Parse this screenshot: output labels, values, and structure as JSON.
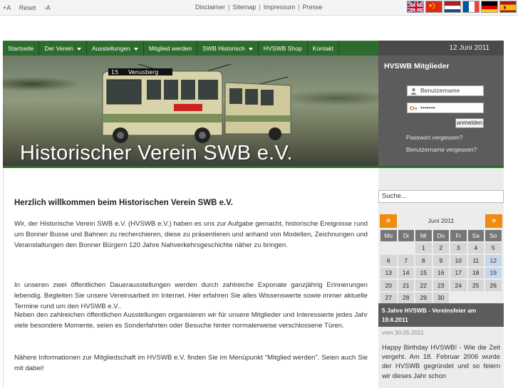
{
  "topbar": {
    "fontsize": [
      "+A",
      "Reset",
      "-A"
    ],
    "links": [
      "Disclaimer",
      "Sitemap",
      "Impressum",
      "Presse"
    ],
    "flags": [
      "UK",
      "China",
      "Netherlands",
      "France",
      "Germany",
      "Spain"
    ]
  },
  "nav": {
    "items": [
      {
        "label": "Startseite",
        "dropdown": false
      },
      {
        "label": "Der Verein",
        "dropdown": true
      },
      {
        "label": "Ausstellungen",
        "dropdown": true
      },
      {
        "label": "Mitglied werden",
        "dropdown": false
      },
      {
        "label": "SWB Historisch",
        "dropdown": true
      },
      {
        "label": "HVSWB Shop",
        "dropdown": false
      },
      {
        "label": "Kontakt",
        "dropdown": false
      }
    ],
    "date": "12 Juni 2011"
  },
  "header": {
    "title": "Historischer Verein SWB e.V.",
    "bus_destination": "Venusberg",
    "bus_number": "15"
  },
  "login": {
    "title": "HVSWB Mitglieder",
    "username_placeholder": "Benutzername",
    "password_value": "•••••••",
    "button": "anmelden",
    "forgot_password": "Passwort vergessen?",
    "forgot_username": "Benutzername vergessen?"
  },
  "main": {
    "heading": "Herzlich willkommen beim Historischen Verein SWB e.V.",
    "paragraphs": [
      "Wir, der Historische Verein SWB e.V. (HVSWB e.V.) haben es uns zur Aufgabe gemacht, historische Ereignisse rund um Bonner Busse und Bahnen zu recherchieren, diese zu präsentieren und anhand von Modellen, Zeichnungen und Veranstaltungen den Bonner Bürgern 120 Jahre Nahverkehrsgeschichte näher zu bringen.",
      "In unseren zwei öffentlichen Dauerausstellungen werden durch zahlreiche Exponate ganzjährig Erinnerungen lebendig. Begleiten Sie unsere Vereinsarbeit im Internet. Hier erfahren Sie alles Wissenswerte sowie immer aktuelle Termine rund um den HVSWB e.V..",
      "Neben den zahlreichen öffentlichen Ausstellungen organisieren wir für unsere Mitglieder und Interessierte jedes Jahr viele besondere Momente, seien es Sonderfahrten oder Besuche hinter normalerweise verschlossene Türen.",
      "Nähere Informationen zur Mitgliedschaft im HVSWB e.V. finden Sie im Menüpunkt \"Mitglied werden\". Seien auch Sie mit dabei!"
    ]
  },
  "sidebar": {
    "search_placeholder": "Suche...",
    "calendar": {
      "prev": "«",
      "next": "»",
      "month": "Juni 2011",
      "weekdays": [
        "Mo",
        "Di",
        "Mi",
        "Do",
        "Fr",
        "Sa",
        "So"
      ],
      "weeks": [
        [
          "",
          "",
          "1",
          "2",
          "3",
          "4",
          "5"
        ],
        [
          "6",
          "7",
          "8",
          "9",
          "10",
          "11",
          "12"
        ],
        [
          "13",
          "14",
          "15",
          "16",
          "17",
          "18",
          "19"
        ],
        [
          "20",
          "21",
          "22",
          "23",
          "24",
          "25",
          "26"
        ],
        [
          "27",
          "28",
          "29",
          "30",
          "",
          "",
          ""
        ]
      ],
      "today": "12",
      "marked": [
        "19"
      ]
    },
    "news": {
      "title": "5 Jahre HVSWB - Vereinsfeier am 19.6.2011",
      "date": "vom 30.05.2011",
      "text": "Happy Birthday HVSWB! - Wie die Zeit vergeht. Am 18. Februar 2006 wurde der HVSWB gegründet und so feiern wir dieses Jahr schon"
    }
  },
  "colors": {
    "nav_green": "#2e6b2e",
    "panel_grey": "#5c5c5c",
    "accent_orange": "#f08a10"
  }
}
